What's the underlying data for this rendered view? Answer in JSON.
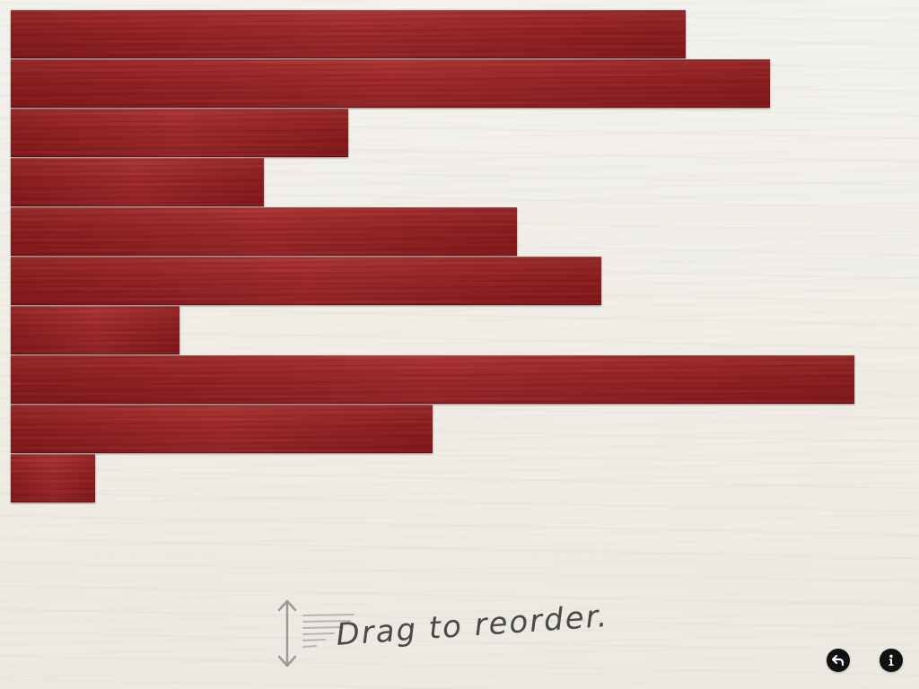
{
  "game": {
    "instruction": "Drag to reorder.",
    "plank_color": "#9e2426",
    "planks": [
      {
        "id": "plank-1",
        "length": 8
      },
      {
        "id": "plank-2",
        "length": 9
      },
      {
        "id": "plank-3",
        "length": 4
      },
      {
        "id": "plank-4",
        "length": 3
      },
      {
        "id": "plank-5",
        "length": 6
      },
      {
        "id": "plank-6",
        "length": 7
      },
      {
        "id": "plank-7",
        "length": 2
      },
      {
        "id": "plank-8",
        "length": 10
      },
      {
        "id": "plank-9",
        "length": 5
      },
      {
        "id": "plank-10",
        "length": 1
      }
    ]
  },
  "controls": {
    "undo_icon": "undo-arrow-icon",
    "info_icon": "info-icon"
  }
}
